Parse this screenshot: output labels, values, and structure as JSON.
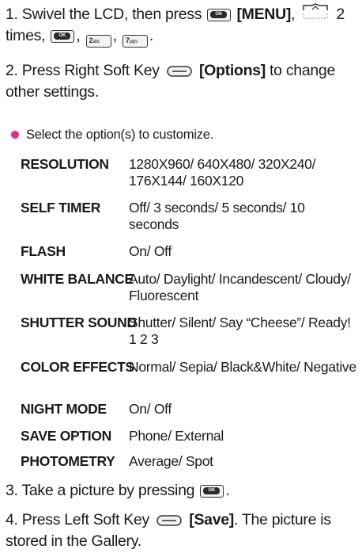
{
  "steps": {
    "step1": {
      "num": "1.",
      "text_a": "Swivel the LCD, then press",
      "menu": "[MENU]",
      "comma": ",",
      "times": "2 times,",
      "sep": ",",
      "key_2_digit": "2",
      "key_2_letters": "abc",
      "key_7_digit": "7",
      "key_7_letters": "pqrs",
      "end": "."
    },
    "step2": {
      "num": "2.",
      "text_a": "Press Right Soft Key",
      "options": "[Options]",
      "text_b": "to change other settings."
    },
    "step3": {
      "num": "3.",
      "text_a": "Take a picture by pressing",
      "end": "."
    },
    "step4": {
      "num": "4.",
      "text_a": "Press Left Soft Key",
      "save": "[Save]",
      "text_b": ". The picture is stored in the Gallery."
    }
  },
  "ok_key_label": "OK",
  "bullet": {
    "text": "Select the option(s) to customize.",
    "color": "#e8258c"
  },
  "options": [
    {
      "name": "RESOLUTION",
      "value": "1280X960/ 640X480/ 320X240/ 176X144/ 160X120"
    },
    {
      "name": "SELF TIMER",
      "value": "Off/ 3 seconds/ 5 seconds/ 10 seconds"
    },
    {
      "name": "FLASH",
      "value": "On/ Off"
    },
    {
      "name": "WHITE BALANCE",
      "value": "Auto/ Daylight/ Incandescent/ Cloudy/ Fluorescent"
    },
    {
      "name": "SHUTTER SOUND",
      "value": "Shutter/ Silent/ Say “Cheese”/ Ready! 1 2 3"
    },
    {
      "name": "COLOR EFFECTS",
      "value": "Normal/ Sepia/ Black&White/ Negative"
    },
    {
      "name": "NIGHT MODE",
      "value": "On/ Off"
    },
    {
      "name": "SAVE OPTION",
      "value": "Phone/ External"
    },
    {
      "name": "PHOTOMETRY",
      "value": "Average/ Spot"
    }
  ]
}
